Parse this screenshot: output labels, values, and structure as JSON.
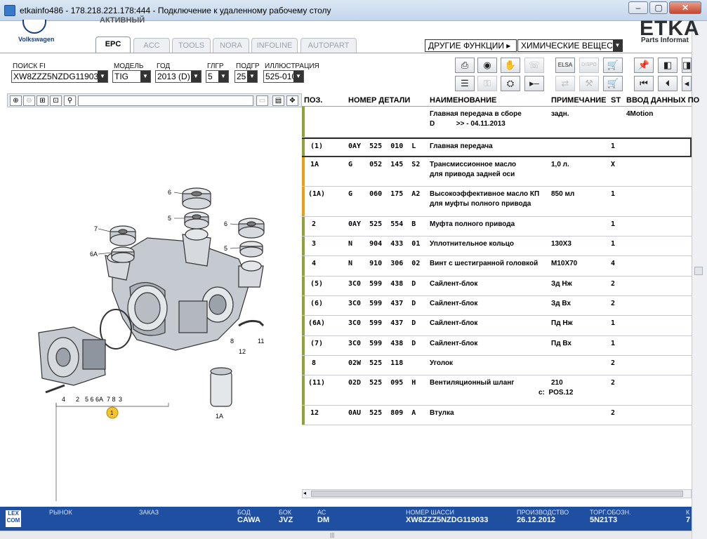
{
  "window": {
    "title": "etkainfo486 - 178.218.221.178:444 - Подключение к удаленному рабочему столу",
    "minimize": "‒",
    "maximize": "▢",
    "close": "✕"
  },
  "header": {
    "brand": "Volkswagen",
    "active_label": "АКТИВНЫЙ",
    "logo_text": "ETKA",
    "logo_sub": "Parts Informat"
  },
  "tabs": [
    {
      "label": "EPC"
    },
    {
      "label": "ACC"
    },
    {
      "label": "TOOLS"
    },
    {
      "label": "NORA"
    },
    {
      "label": "INFOLINE"
    },
    {
      "label": "AUTOPART"
    }
  ],
  "functions": {
    "other": "ДРУГИЕ ФУНКЦИИ ▸",
    "chemicals": "ХИМИЧЕСКИЕ ВЕЩЕСТВ"
  },
  "filters": {
    "search": {
      "label": "ПОИСК FI",
      "value": "XW8ZZZ5NZDG119033"
    },
    "model": {
      "label": "МОДЕЛЬ",
      "value": "TIG"
    },
    "year": {
      "label": "ГОД",
      "value": "2013 (D)"
    },
    "main_group": {
      "label": "ГЛГР",
      "value": "5"
    },
    "sub_group": {
      "label": "ПОДГР",
      "value": "25"
    },
    "illustration": {
      "label": "ИЛЛЮСТРАЦИЯ",
      "value": "525-010"
    }
  },
  "table": {
    "headers": {
      "pos": "ПОЗ.",
      "part": "НОМЕР ДЕТАЛИ",
      "name": "НАИМЕНОВАНИЕ",
      "note": "ПРИМЕЧАНИЕ",
      "qty": "ST",
      "input": "ВВОД ДАННЫХ ПО"
    },
    "group_header": {
      "name1": "Главная передача в сборе",
      "name2": "D           >> - 04.11.2013",
      "note": "задн.",
      "input": "4Motion"
    },
    "rows": [
      {
        "pos": "(1)",
        "part": "0AY  525  010  L",
        "name": "Главная передача",
        "name2": "",
        "note": "",
        "note2": "",
        "qty": "1"
      },
      {
        "pos": "1A",
        "part": "G    052  145  S2",
        "name": "Трансмиссионное масло",
        "name2": "для привода задней оси",
        "note": "1,0 л.",
        "note2": "",
        "qty": "X"
      },
      {
        "pos": "(1A)",
        "part": "G    060  175  A2",
        "name": "Высокоэффективное масло КП",
        "name2": "для муфты полного привода",
        "note": "850 мл",
        "note2": "",
        "qty": "1"
      },
      {
        "pos": "2",
        "part": "0AY  525  554  B",
        "name": "Муфта полного привода",
        "name2": "",
        "note": "",
        "note2": "",
        "qty": "1"
      },
      {
        "pos": "3",
        "part": "N    904  433  01",
        "name": "Уплотнительное кольцо",
        "name2": "",
        "note": "130X3",
        "note2": "",
        "qty": "1"
      },
      {
        "pos": "4",
        "part": "N    910  306  02",
        "name": "Винт с шестигранной головкой",
        "name2": "",
        "note": "M10X70",
        "note2": "",
        "qty": "4"
      },
      {
        "pos": "(5)",
        "part": "3C0  599  438  D",
        "name": "Сайлент-блок",
        "name2": "",
        "note": "Зд Нж",
        "note2": "",
        "qty": "2"
      },
      {
        "pos": "(6)",
        "part": "3C0  599  437  D",
        "name": "Сайлент-блок",
        "name2": "",
        "note": "Зд Вх",
        "note2": "",
        "qty": "2"
      },
      {
        "pos": "(6A)",
        "part": "3C0  599  437  D",
        "name": "Сайлент-блок",
        "name2": "",
        "note": "Пд Нж",
        "note2": "",
        "qty": "1"
      },
      {
        "pos": "(7)",
        "part": "3C0  599  438  D",
        "name": "Сайлент-блок",
        "name2": "",
        "note": "Пд Вх",
        "note2": "",
        "qty": "1"
      },
      {
        "pos": "8",
        "part": "02W  525  118",
        "name": "Уголок",
        "name2": "",
        "note": "",
        "note2": "",
        "qty": "2"
      },
      {
        "pos": "(11)",
        "part": "02D  525  095  H",
        "name": "Вентиляционный шланг",
        "name2": "",
        "note": "210",
        "note2": "c:  POS.12",
        "qty": "2"
      },
      {
        "pos": "12",
        "part": "0AU  525  809  A",
        "name": "Втулка",
        "name2": "",
        "note": "",
        "note2": "",
        "qty": "2"
      }
    ]
  },
  "illustration_labels": {
    "l6a": "6",
    "l5a": "5",
    "l7": "7",
    "l6A": "6A",
    "l6b": "6",
    "l5b": "5",
    "l8": "8",
    "l12": "12",
    "l11": "11",
    "l4": "4",
    "l2": "2",
    "l56": "5 6 6A",
    "l78": "7 8",
    "l3": "3",
    "l1": "1",
    "l1A": "1A"
  },
  "status": {
    "market": {
      "label": "РЫНОК",
      "value": ""
    },
    "order": {
      "label": "ЗАКАЗ",
      "value": ""
    },
    "bod": {
      "label": "БОД",
      "value": "CAWA"
    },
    "bok": {
      "label": "БОК",
      "value": "JVZ"
    },
    "ac": {
      "label": "АС",
      "value": "DM"
    },
    "chassis": {
      "label": "НОМЕР ШАССИ",
      "value": "XW8ZZZ5NZDG119033"
    },
    "production": {
      "label": "ПРОИЗВОДСТВО",
      "value": "26.12.2012"
    },
    "trade": {
      "label": "ТОРГ.ОБОЗН.",
      "value": "5N21T3"
    },
    "k": {
      "label": "К",
      "value": "7"
    },
    "lex": "LEX\nCOM"
  },
  "colors": {
    "accent_olive": "#8fa13a",
    "accent_orange": "#e6a01a",
    "status_bg": "#1f4fa0",
    "marker_yellow": "#f4c430"
  }
}
